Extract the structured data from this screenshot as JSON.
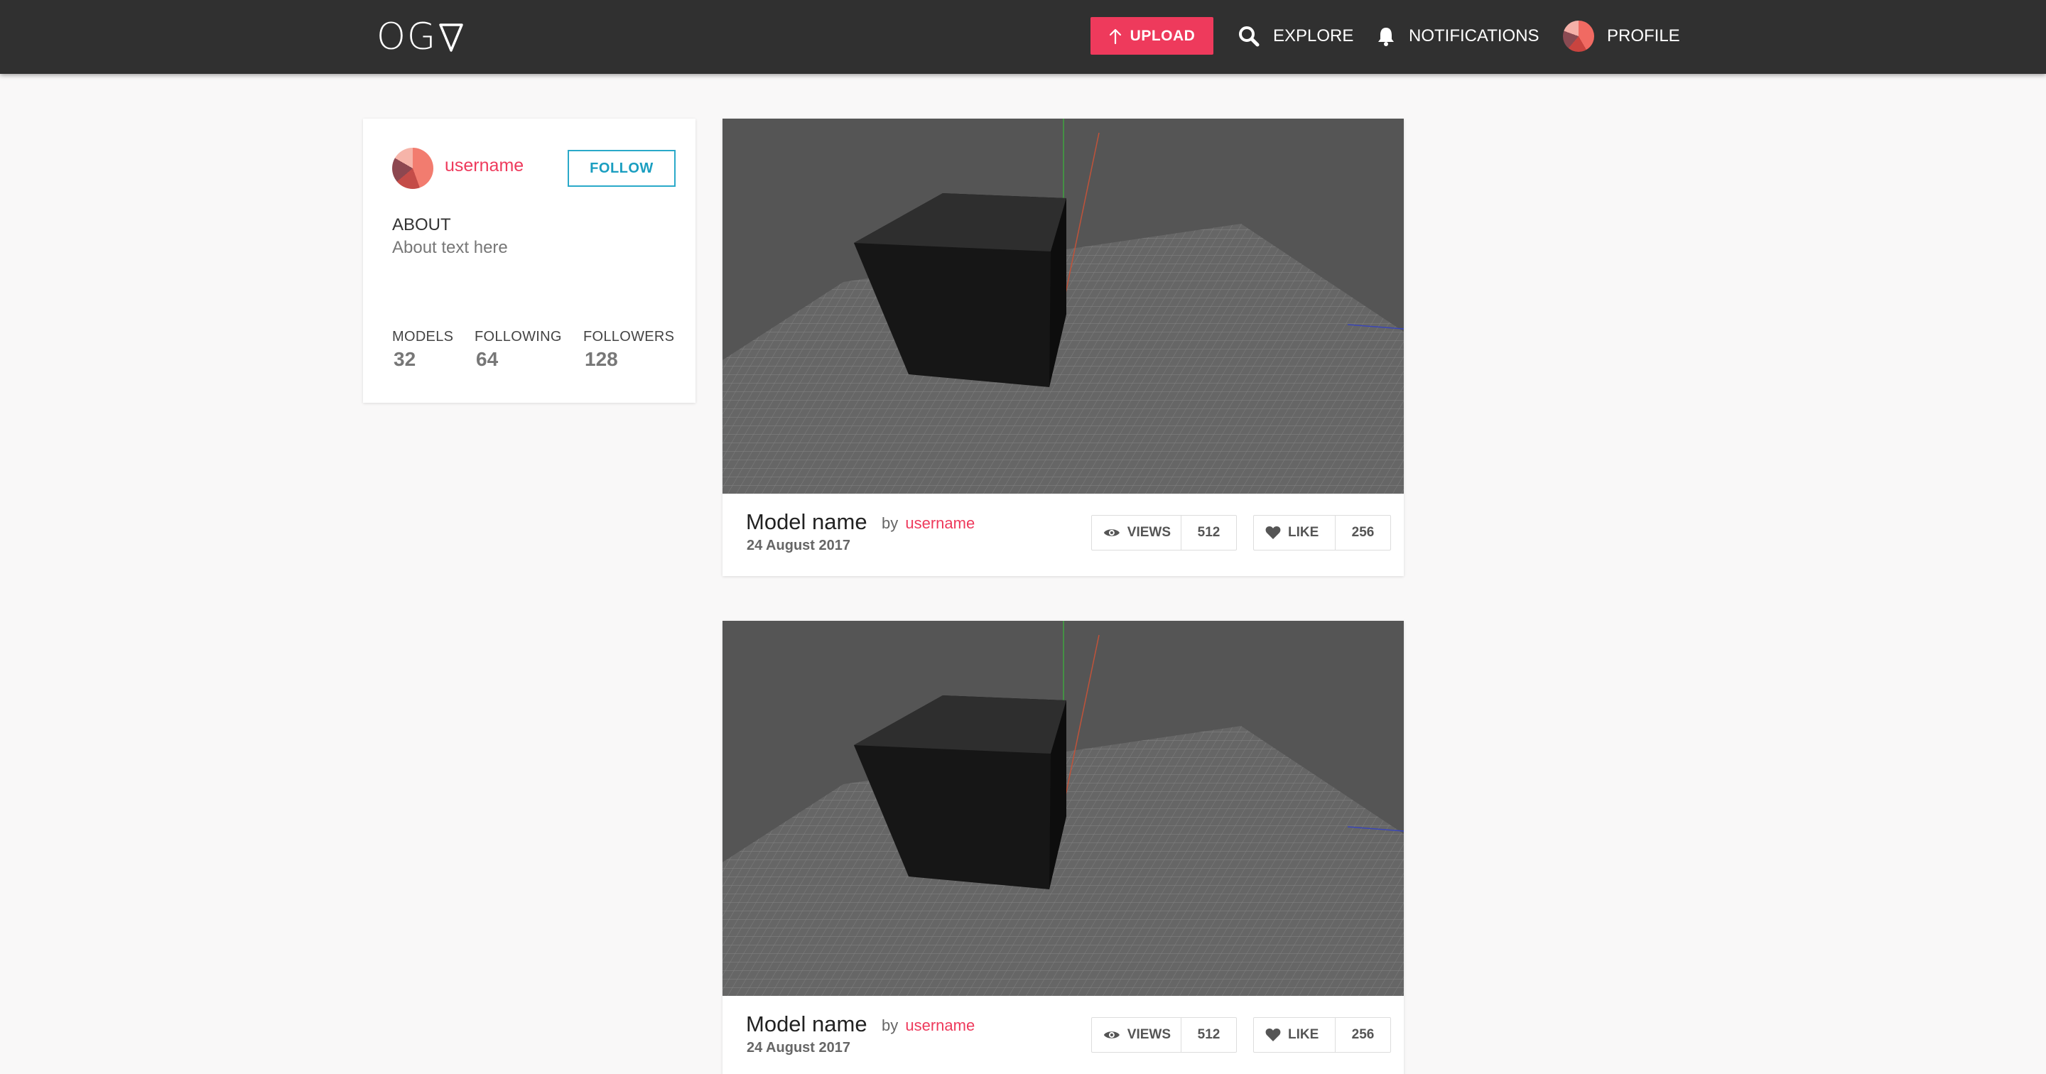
{
  "topbar": {
    "logo_text": "OG",
    "upload_label": "UPLOAD",
    "explore_label": "EXPLORE",
    "notifications_label": "NOTIFICATIONS",
    "profile_label": "PROFILE",
    "icons": [
      "upload-arrow-icon",
      "search-icon",
      "bell-icon",
      "avatar"
    ],
    "accent_color": "#ee3a5c",
    "bar_color": "#303030"
  },
  "profile": {
    "username": "username",
    "follow_label": "FOLLOW",
    "about_heading": "ABOUT",
    "about_text": "About text here",
    "stats": {
      "models_label": "MODELS",
      "models_value": "32",
      "following_label": "FOLLOWING",
      "following_value": "64",
      "followers_label": "FOLLOWERS",
      "followers_value": "128"
    }
  },
  "models": [
    {
      "name": "Model name",
      "by_label": "by",
      "author": "username",
      "date": "24 August 2017",
      "views_label": "VIEWS",
      "views_count": "512",
      "like_label": "LIKE",
      "like_count": "256"
    },
    {
      "name": "Model name",
      "by_label": "by",
      "author": "username",
      "date": "24 August 2017",
      "views_label": "VIEWS",
      "views_count": "512",
      "like_label": "LIKE",
      "like_count": "256"
    }
  ]
}
